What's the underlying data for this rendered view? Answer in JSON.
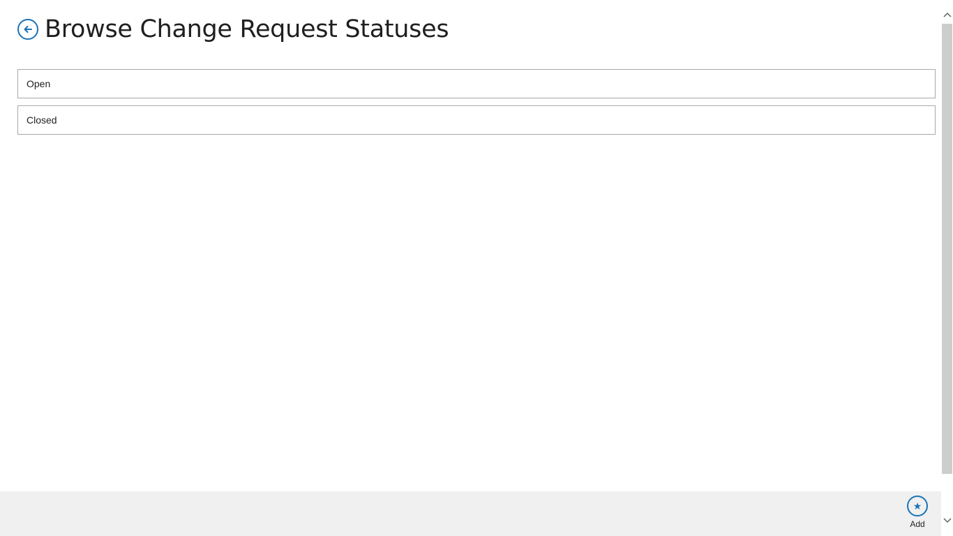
{
  "header": {
    "title": "Browse Change Request Statuses",
    "back_icon": "back-arrow-icon"
  },
  "statuses": [
    {
      "label": "Open"
    },
    {
      "label": "Closed"
    }
  ],
  "app_bar": {
    "add_label": "Add",
    "add_icon": "star-icon",
    "add_glyph": "★"
  },
  "colors": {
    "accent": "#1a73b5",
    "app_bar_background": "#f0f0f0",
    "item_border": "#a9a9a9"
  }
}
